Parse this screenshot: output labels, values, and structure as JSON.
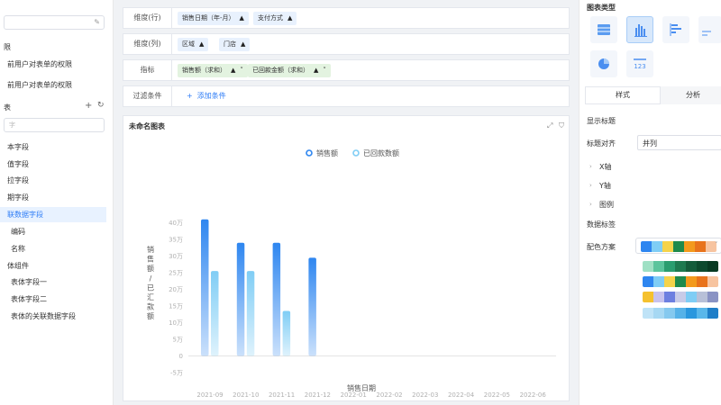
{
  "left": {
    "section1": "限",
    "perm1": "前用户对表单的权限",
    "perm2": "前用户对表单的权限",
    "section2": "表",
    "search_placeholder": "字",
    "fields": [
      {
        "label": "本字段",
        "indent": false
      },
      {
        "label": "值字段",
        "indent": false
      },
      {
        "label": "拉字段",
        "indent": false
      },
      {
        "label": "期字段",
        "indent": false
      },
      {
        "label": "联数据字段",
        "indent": false,
        "selected": true
      },
      {
        "label": "编码",
        "indent": true
      },
      {
        "label": "名称",
        "indent": true
      },
      {
        "label": "体组件",
        "indent": false
      },
      {
        "label": "表体字段一",
        "indent": true
      },
      {
        "label": "表体字段二",
        "indent": true
      },
      {
        "label": "表体的关联数据字段",
        "indent": true
      }
    ]
  },
  "config": {
    "row_dimension_label": "维度(行)",
    "row_chips": [
      "销售日期（年-月）",
      "支付方式"
    ],
    "col_dimension_label": "维度(列)",
    "col_chips": [
      "区域",
      "门店"
    ],
    "metric_label": "指标",
    "metric_chips": [
      "销售额（求和）",
      "已回款金额（求和）"
    ],
    "filter_label": "过滤条件",
    "add_condition": "添加条件"
  },
  "chart": {
    "title": "未命名图表"
  },
  "chart_data": {
    "type": "bar",
    "categories": [
      "2021-09",
      "2021-10",
      "2021-11",
      "2021-12",
      "2022-01",
      "2022-02",
      "2022-03",
      "2022-04",
      "2022-05",
      "2022-06"
    ],
    "series": [
      {
        "name": "销售额",
        "values": [
          41,
          34,
          34,
          29.5,
          0,
          0,
          0,
          0,
          0,
          0
        ],
        "color": "#2e86f0"
      },
      {
        "name": "已回款数额",
        "values": [
          25.5,
          25.5,
          13.5,
          0,
          0,
          0,
          0,
          0,
          0,
          0
        ],
        "color": "#7fcdf5"
      }
    ],
    "xlabel": "销售日期",
    "ylabel": "销售额/已汇款额",
    "ylim": [
      -5,
      45
    ],
    "yticks": [
      "-5万",
      "0",
      "5万",
      "10万",
      "15万",
      "20万",
      "25万",
      "30万",
      "35万",
      "40万"
    ],
    "yticks_values": [
      -5,
      0,
      5,
      10,
      15,
      20,
      25,
      30,
      35,
      40
    ],
    "grid": false,
    "legend": "top-center"
  },
  "right": {
    "chart_type_title": "图表类型",
    "tab_style": "样式",
    "tab_analysis": "分析",
    "show_title": "显示标题",
    "title_align": "标题对齐",
    "title_align_value": "并列",
    "x_axis": "X轴",
    "y_axis": "Y轴",
    "legend": "图例",
    "data_label": "数据标签",
    "color_scheme": "配色方案",
    "table_icon_text": "123",
    "palettes": [
      [
        "#2e86f0",
        "#7fcdf5",
        "#f5d34a",
        "#1f8a4c",
        "#f39a1d",
        "#e8731c",
        "#f7c4a0"
      ],
      [
        "#9fe0c4",
        "#5bc49c",
        "#2a9d6f",
        "#1e7a50",
        "#145c3b",
        "#0d4a2e",
        "#083a22"
      ],
      [
        "#2e86f0",
        "#7fcdf5",
        "#f5d34a",
        "#1f8a4c",
        "#f39a1d",
        "#e8731c",
        "#f7c4a0"
      ],
      [
        "#f5c12e",
        "#c7c2ee",
        "#6d7fe0",
        "#c8cbe8",
        "#7fcdf5",
        "#b8c0d8",
        "#8a93c4"
      ],
      [
        "#bfe3f7",
        "#a6d8f3",
        "#85c9ef",
        "#56b2e8",
        "#2a97de",
        "#5ab7ea",
        "#1f7ec8"
      ]
    ]
  }
}
